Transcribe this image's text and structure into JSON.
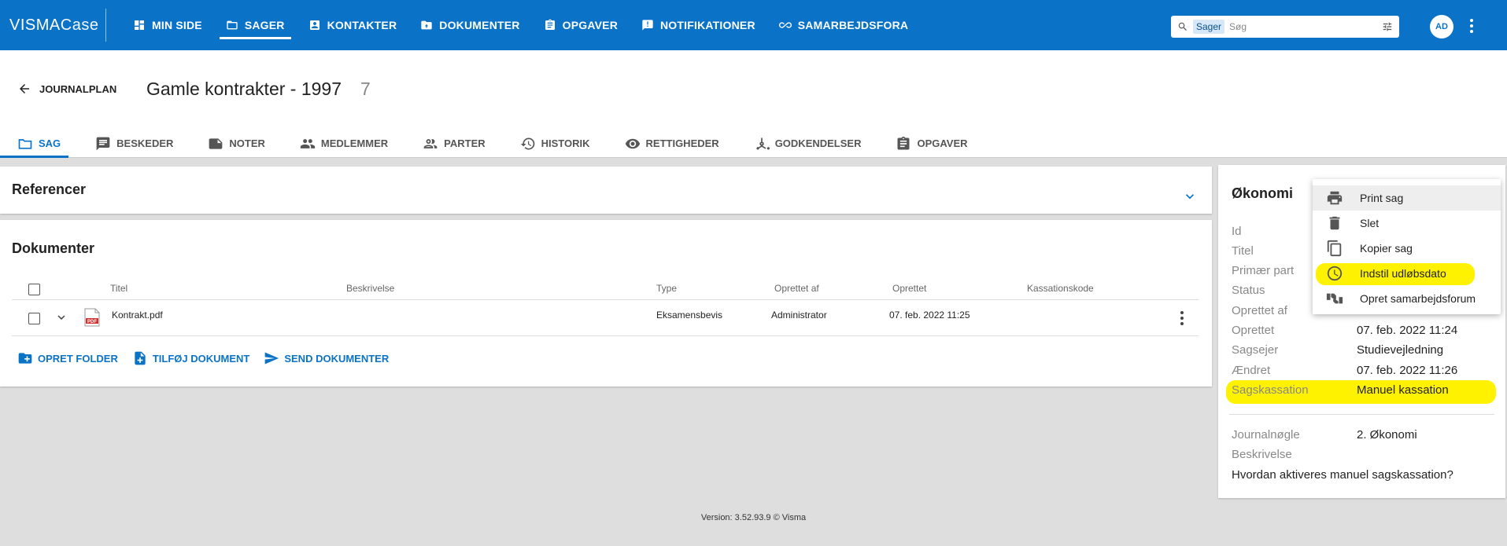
{
  "brand": {
    "name_a": "VISMA",
    "name_b": "Case"
  },
  "nav": [
    {
      "label": "MIN SIDE",
      "icon": "dashboard-icon"
    },
    {
      "label": "SAGER",
      "icon": "folder-icon",
      "active": true
    },
    {
      "label": "KONTAKTER",
      "icon": "contact-icon"
    },
    {
      "label": "DOKUMENTER",
      "icon": "doc-folder-icon"
    },
    {
      "label": "OPGAVER",
      "icon": "clipboard-icon"
    },
    {
      "label": "NOTIFIKATIONER",
      "icon": "notification-icon"
    },
    {
      "label": "SAMARBEJDSFORA",
      "icon": "infinity-icon"
    }
  ],
  "search": {
    "chip": "Sager",
    "placeholder": "Søg"
  },
  "user": {
    "initials": "AD"
  },
  "header": {
    "back_label": "JOURNALPLAN",
    "title": "Gamle kontrakter - 1997",
    "count": "7"
  },
  "tabs": [
    {
      "label": "SAG",
      "active": true
    },
    {
      "label": "BESKEDER"
    },
    {
      "label": "NOTER"
    },
    {
      "label": "MEDLEMMER"
    },
    {
      "label": "PARTER"
    },
    {
      "label": "HISTORIK"
    },
    {
      "label": "RETTIGHEDER"
    },
    {
      "label": "GODKENDELSER"
    },
    {
      "label": "OPGAVER"
    }
  ],
  "references": {
    "title": "Referencer"
  },
  "documents": {
    "title": "Dokumenter",
    "columns": [
      "Titel",
      "Beskrivelse",
      "Type",
      "Oprettet af",
      "Oprettet",
      "Kassationskode"
    ],
    "rows": [
      {
        "title": "Kontrakt.pdf",
        "description": "",
        "type": "Eksamensbevis",
        "created_by": "Administrator",
        "created": "07. feb. 2022 11:25",
        "code": ""
      }
    ],
    "actions": [
      "OPRET FOLDER",
      "TILFØJ DOKUMENT",
      "SEND DOKUMENTER"
    ]
  },
  "side": {
    "title": "Økonomi",
    "fields": [
      {
        "label": "Id",
        "value": ""
      },
      {
        "label": "Titel",
        "value": ""
      },
      {
        "label": "Primær part",
        "value": ""
      },
      {
        "label": "Status",
        "value": ""
      },
      {
        "label": "Oprettet af",
        "value": ""
      },
      {
        "label": "Oprettet",
        "value": "07. feb. 2022 11:24"
      },
      {
        "label": "Sagsejer",
        "value": "Studievejledning"
      },
      {
        "label": "Ændret",
        "value": "07. feb. 2022 11:26"
      },
      {
        "label": "Sagskassation",
        "value": "Manuel kassation"
      }
    ],
    "journal_key_label": "Journalnøgle",
    "journal_key_value": "2. Økonomi",
    "description_label": "Beskrivelse",
    "question": "Hvordan aktiveres manuel sagskassation?"
  },
  "menu": [
    {
      "label": "Print sag",
      "icon": "print-icon"
    },
    {
      "label": "Slet",
      "icon": "trash-icon"
    },
    {
      "label": "Kopier sag",
      "icon": "copy-icon"
    },
    {
      "label": "Indstil udløbsdato",
      "icon": "clock-icon"
    },
    {
      "label": "Opret samarbejdsforum",
      "icon": "handshake-icon"
    }
  ],
  "footer": "Version: 3.52.93.9   © Visma",
  "colors": {
    "primary": "#0a73c8",
    "highlight": "#fff200"
  }
}
